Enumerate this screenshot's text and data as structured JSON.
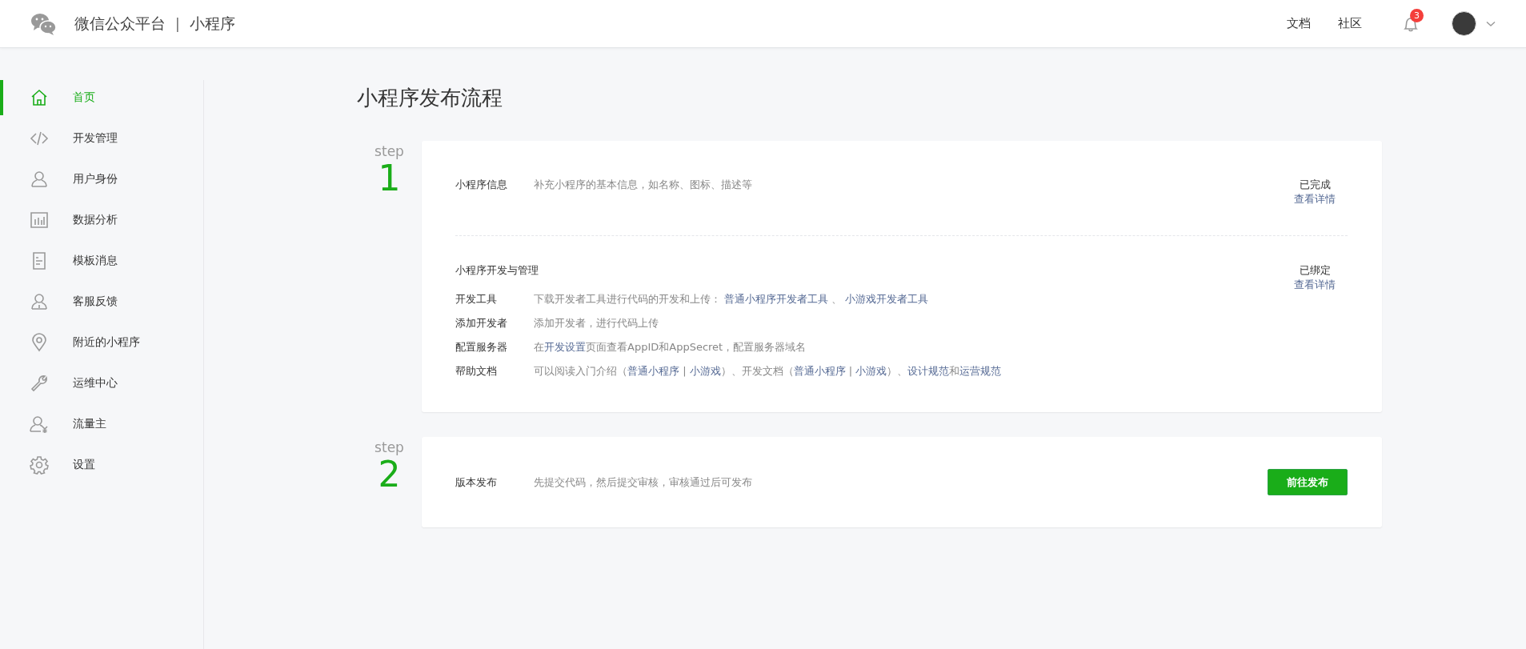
{
  "header": {
    "brand": "微信公众平台",
    "separator": "|",
    "product": "小程序",
    "links": [
      "文档",
      "社区"
    ],
    "notification_count": "3"
  },
  "sidebar": {
    "items": [
      {
        "label": "首页",
        "kind": "home",
        "selected": true
      },
      {
        "label": "开发管理",
        "kind": "code",
        "selected": false
      },
      {
        "label": "用户身份",
        "kind": "user",
        "selected": false
      },
      {
        "label": "数据分析",
        "kind": "chart",
        "selected": false
      },
      {
        "label": "模板消息",
        "kind": "document",
        "selected": false
      },
      {
        "label": "客服反馈",
        "kind": "service",
        "selected": false
      },
      {
        "label": "附近的小程序",
        "kind": "location",
        "selected": false
      },
      {
        "label": "运维中心",
        "kind": "wrench",
        "selected": false
      },
      {
        "label": "流量主",
        "kind": "yen-user",
        "selected": false
      },
      {
        "label": "设置",
        "kind": "gear",
        "selected": false
      }
    ]
  },
  "page_title": "小程序发布流程",
  "steps": [
    {
      "label": "step",
      "number": "1",
      "sections": [
        {
          "title": "小程序信息",
          "description": [
            {
              "text": "补充小程序的基本信息，如名称、图标、描述等"
            }
          ],
          "status": "已完成",
          "detail_link": "查看详情"
        },
        {
          "title": "小程序开发与管理",
          "status": "已绑定",
          "detail_link": "查看详情",
          "rows": [
            {
              "label": "开发工具",
              "description": [
                {
                  "text": "下载开发者工具进行代码的开发和上传： "
                },
                {
                  "text": "普通小程序开发者工具",
                  "link": true
                },
                {
                  "text": " 、 "
                },
                {
                  "text": "小游戏开发者工具",
                  "link": true
                }
              ]
            },
            {
              "label": "添加开发者",
              "description": [
                {
                  "text": "添加开发者，进行代码上传"
                }
              ]
            },
            {
              "label": "配置服务器",
              "description": [
                {
                  "text": "在"
                },
                {
                  "text": "开发设置",
                  "link": true
                },
                {
                  "text": "页面查看AppID和AppSecret，配置服务器域名"
                }
              ]
            },
            {
              "label": "帮助文档",
              "description": [
                {
                  "text": "可以阅读入门介绍（"
                },
                {
                  "text": "普通小程序",
                  "link": true
                },
                {
                  "text": " | "
                },
                {
                  "text": "小游戏",
                  "link": true
                },
                {
                  "text": "）、开发文档（"
                },
                {
                  "text": "普通小程序",
                  "link": true
                },
                {
                  "text": " | "
                },
                {
                  "text": "小游戏",
                  "link": true
                },
                {
                  "text": "）、"
                },
                {
                  "text": "设计规范",
                  "link": true
                },
                {
                  "text": "和"
                },
                {
                  "text": "运营规范",
                  "link": true
                }
              ]
            }
          ]
        }
      ]
    },
    {
      "label": "step",
      "number": "2",
      "sections": [
        {
          "title": "版本发布",
          "description": [
            {
              "text": "先提交代码，然后提交审核，审核通过后可发布"
            }
          ],
          "action": "前往发布"
        }
      ]
    }
  ]
}
